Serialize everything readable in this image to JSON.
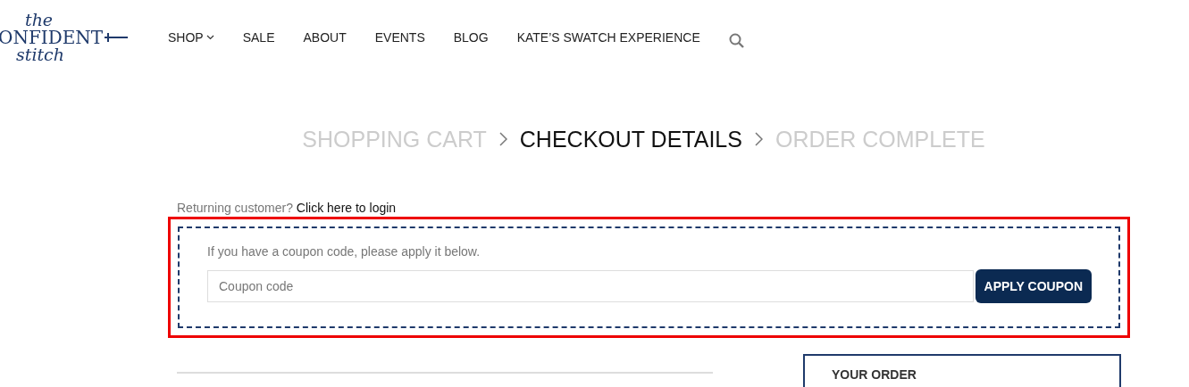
{
  "logo": {
    "top": "the",
    "middle": "ONFIDENT",
    "bottom": "stitch"
  },
  "nav": [
    {
      "label": "SHOP",
      "dropdown": true
    },
    {
      "label": "SALE",
      "dropdown": false
    },
    {
      "label": "ABOUT",
      "dropdown": false
    },
    {
      "label": "EVENTS",
      "dropdown": false
    },
    {
      "label": "BLOG",
      "dropdown": false
    },
    {
      "label": "KATE’S SWATCH EXPERIENCE",
      "dropdown": false
    }
  ],
  "steps": [
    {
      "label": "SHOPPING CART",
      "selected": false
    },
    {
      "label": "CHECKOUT DETAILS",
      "selected": true
    },
    {
      "label": "ORDER COMPLETE",
      "selected": false
    }
  ],
  "login": {
    "prompt": "Returning customer?",
    "link": "Click here to login"
  },
  "coupon": {
    "message": "If you have a coupon code, please apply it below.",
    "placeholder": "Coupon code",
    "button": "APPLY COUPON"
  },
  "order": {
    "title": "YOUR ORDER"
  }
}
